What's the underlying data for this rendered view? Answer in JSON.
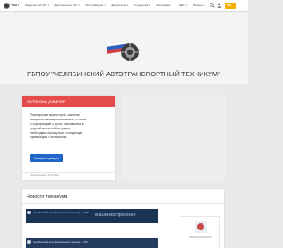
{
  "navbar": {
    "brand": "ЧАТТ",
    "items": [
      {
        "label": "Сведения об ОО"
      },
      {
        "label": "Деятельность ОО"
      },
      {
        "label": "Поступающим"
      },
      {
        "label": "Документы"
      },
      {
        "label": "Студентам"
      },
      {
        "label": "Магистрам"
      },
      {
        "label": "СДО"
      },
      {
        "label": "Прочее"
      }
    ],
    "lang": "RU"
  },
  "header": {
    "title": "ГБПОУ \"ЧЕЛЯБИНСКИЙ АВТОТРАНСПОРТНЫЙ ТЕХНИКУМ\""
  },
  "hotline": {
    "header": "ТЕЛЕФОНЫ ДОВЕРИЯ",
    "body_lines": [
      "По вопросам защиты прав, законных",
      "интересов несовершеннолетних, а также",
      "с информацией о детях, оказавшихся в",
      "трудной жизненной ситуации,",
      "необходимо обращаться в следующие",
      "организации г. Челябинска:"
    ],
    "button": "Телефоны доверия",
    "footer": "Опубликовано: 01.12.2023"
  },
  "news": {
    "title": "Новости техникума",
    "items": [
      {
        "source": "Челябинский автотранспортный техникум - ЧАТТ",
        "heading": "Машиностроение"
      },
      {
        "source": "Челябинский автотранспортный техникум - ЧАТТ"
      }
    ]
  },
  "colors": {
    "hotline_accent": "#e54b4b",
    "primary_button": "#1f66c8",
    "lang_button": "#f3b000"
  }
}
